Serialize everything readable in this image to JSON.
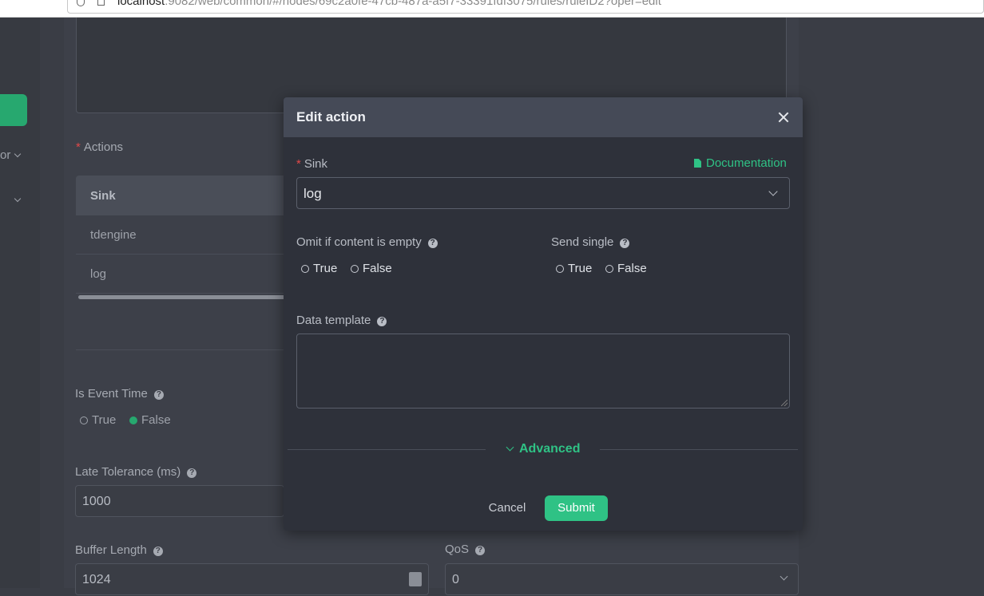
{
  "browser": {
    "url_host": "localhost",
    "url_rest": ":9082/web/common/#/nodes/69c2a0fe-47cb-487a-a5f7-33391fdf3075/rules/ruleID2?oper=edit"
  },
  "sidebar": {
    "item_text": "or"
  },
  "form": {
    "actions_label": "Actions",
    "table_header": "Sink",
    "table_rows": [
      "tdengine",
      "log"
    ],
    "event_time_label": "Is Event Time",
    "event_time_true": "True",
    "event_time_false": "False",
    "event_time_selected": "False",
    "late_tolerance_label": "Late Tolerance (ms)",
    "late_tolerance_value": "1000",
    "buffer_length_label": "Buffer Length",
    "buffer_length_value": "1024",
    "qos_label": "QoS",
    "qos_value": "0"
  },
  "modal": {
    "title": "Edit action",
    "sink_label": "Sink",
    "doc_link": "Documentation",
    "sink_value": "log",
    "omit_label": "Omit if content is empty",
    "send_single_label": "Send single",
    "true_label": "True",
    "false_label": "False",
    "data_template_label": "Data template",
    "data_template_value": "",
    "advanced_label": "Advanced",
    "cancel_label": "Cancel",
    "submit_label": "Submit"
  },
  "colors": {
    "accent": "#2fc285",
    "required": "#e04848",
    "modal_header": "#454a57",
    "modal_body": "#2e313a"
  }
}
